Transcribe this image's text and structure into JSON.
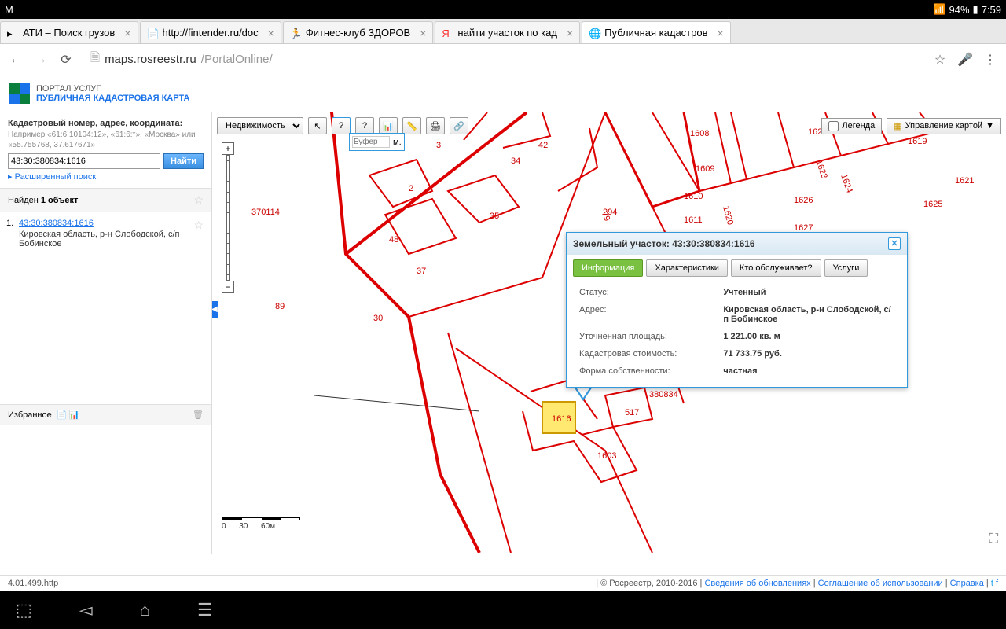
{
  "statusbar": {
    "battery": "94%",
    "time": "7:59"
  },
  "tabs": [
    {
      "title": "АТИ – Поиск грузов"
    },
    {
      "title": "http://fintender.ru/doc"
    },
    {
      "title": "Фитнес-клуб ЗДОРОВ"
    },
    {
      "title": "найти участок по кад"
    },
    {
      "title": "Публичная кадастров",
      "active": true
    }
  ],
  "url": {
    "host": "maps.rosreestr.ru",
    "path": "/PortalOnline/"
  },
  "header": {
    "t1": "ПОРТАЛ УСЛУГ",
    "t2": "ПУБЛИЧНАЯ КАДАСТРОВАЯ КАРТА"
  },
  "search": {
    "label": "Кадастровый номер, адрес, координата:",
    "hint": "Например «61:6:10104:12», «61:6:*», «Москва» или «55.755768, 37.617671»",
    "value": "43:30:380834:1616",
    "btn": "Найти",
    "adv": "Расширенный поиск"
  },
  "results": {
    "found_pre": "Найден ",
    "found_b": "1 объект",
    "items": [
      {
        "num": "1.",
        "link": "43:30:380834:1616",
        "addr": "Кировская область, р-н Слободской, с/п Бобинское"
      }
    ]
  },
  "favorites": {
    "label": "Избранное"
  },
  "toolbar": {
    "select": "Недвижимость",
    "legend": "Легенда",
    "manage": "Управление картой"
  },
  "buffer": {
    "label": "Буфер",
    "unit": "м."
  },
  "popup": {
    "title": "Земельный участок: 43:30:380834:1616",
    "tabs": [
      "Информация",
      "Характеристики",
      "Кто обслуживает?",
      "Услуги"
    ],
    "rows": [
      {
        "k": "Статус:",
        "v": "Учтенный"
      },
      {
        "k": "Адрес:",
        "v": "Кировская область, р-н Слободской, с/п Бобинское"
      },
      {
        "k": "Уточненная площадь:",
        "v": "1 221.00 кв. м"
      },
      {
        "k": "Кадастровая стоимость:",
        "v": "71 733.75 руб."
      },
      {
        "k": "Форма собственности:",
        "v": "частная"
      }
    ]
  },
  "scale": {
    "labels": [
      "0",
      "30",
      "60м"
    ]
  },
  "map_labels": {
    "district": "370114",
    "thirty": "30",
    "eightynine": "89"
  },
  "footer": {
    "version": "4.01.499.http",
    "copyright": "| © Росреестр, 2010-2016 |",
    "links": [
      "Сведения об обновлениях",
      "Соглашение об использовании",
      "Справка"
    ]
  }
}
